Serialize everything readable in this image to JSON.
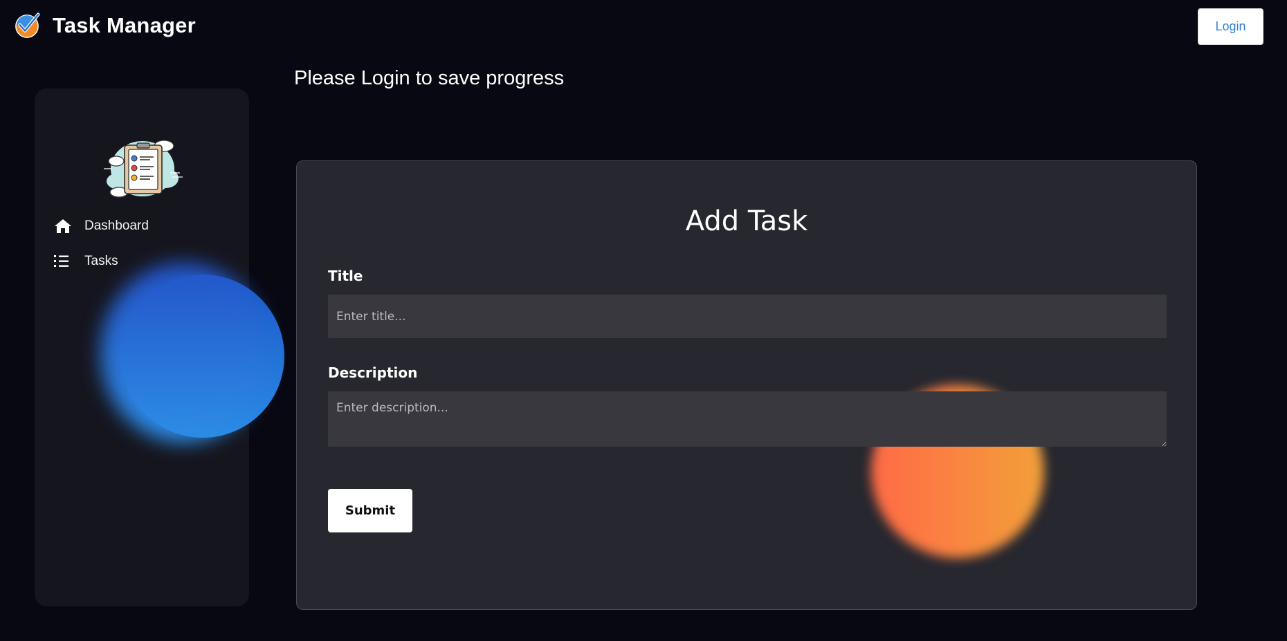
{
  "app": {
    "title": "Task Manager",
    "logo_icon": "checkmark-logo-icon",
    "login_label": "Login"
  },
  "sidebar": {
    "illustration": "checklist-clouds-illustration",
    "items": [
      {
        "label": "Dashboard",
        "icon": "home-icon"
      },
      {
        "label": "Tasks",
        "icon": "list-icon"
      }
    ]
  },
  "main": {
    "notice": "Please Login to save progress",
    "form": {
      "heading": "Add Task",
      "title_label": "Title",
      "title_placeholder": "Enter title...",
      "description_label": "Description",
      "description_placeholder": "Enter description...",
      "submit_label": "Submit"
    }
  },
  "colors": {
    "background": "#080812",
    "sidebar": "#15151d",
    "card": "#27272f",
    "input": "#38383e",
    "login_text": "#2d7fd3",
    "blue_blob": "#2a8de6",
    "orange_blob": "#ff6a46"
  }
}
